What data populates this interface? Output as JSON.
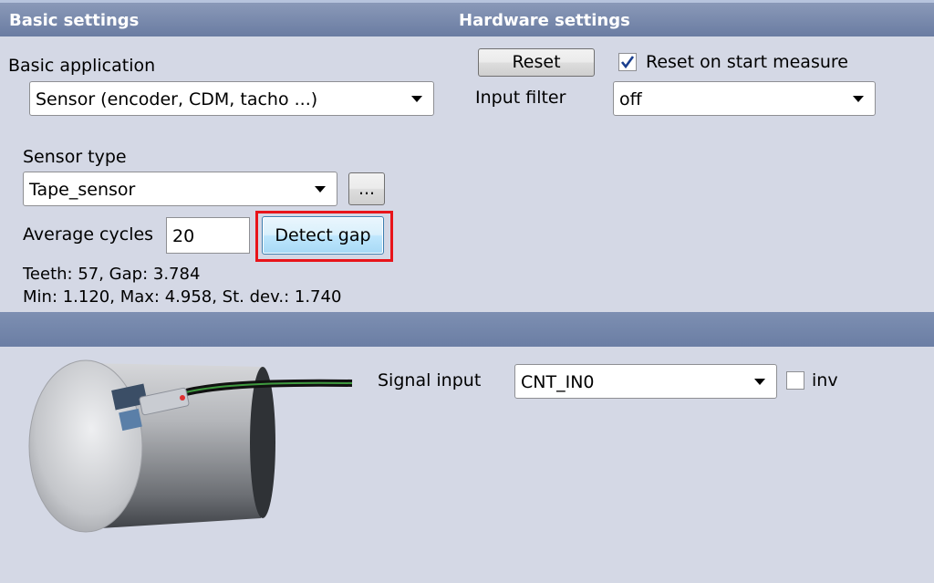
{
  "headers": {
    "basic": "Basic settings",
    "hardware": "Hardware settings"
  },
  "basic": {
    "application_label": "Basic application",
    "application_value": "Sensor (encoder, CDM, tacho ...)",
    "sensor_type_label": "Sensor type",
    "sensor_type_value": "Tape_sensor",
    "more_button": "...",
    "average_cycles_label": "Average cycles",
    "average_cycles_value": "20",
    "detect_gap_button": "Detect gap",
    "info_line1": "Teeth: 57, Gap: 3.784",
    "info_line2": "Min: 1.120, Max: 4.958, St. dev.: 1.740"
  },
  "hardware": {
    "reset_button": "Reset",
    "reset_on_start_label": "Reset on start measure",
    "reset_on_start_checked": true,
    "input_filter_label": "Input filter",
    "input_filter_value": "off"
  },
  "signal": {
    "signal_input_label": "Signal input",
    "signal_input_value": "CNT_IN0",
    "inv_label": "inv",
    "inv_checked": false
  },
  "highlight_color": "#e8141a",
  "icons": {
    "checkbox_checked": "checkmark-icon",
    "dropdown": "chevron-down-icon",
    "illustration": "tape-sensor-cylinder-illustration"
  }
}
